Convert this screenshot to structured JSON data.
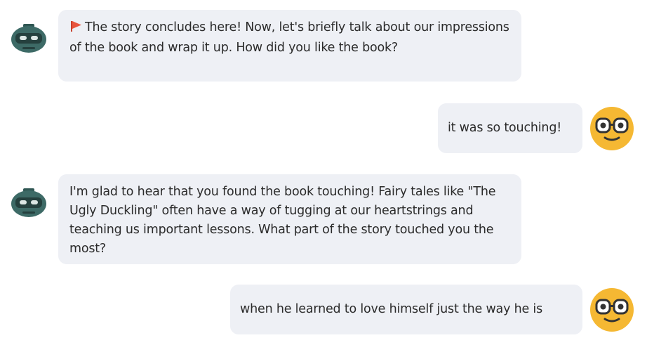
{
  "messages": [
    {
      "sender": "bot",
      "flag_icon": "red-flag-icon",
      "text": "The story concludes here! Now, let's briefly talk about our impressions of the book and wrap it up. How did you like the book?"
    },
    {
      "sender": "user",
      "text": "it was so touching!"
    },
    {
      "sender": "bot",
      "text": "I'm glad to hear that you found the book touching! Fairy tales like \"The Ugly Duckling\" often have a way of tugging at our heartstrings and teaching us important lessons. What part of the story touched you the most?"
    },
    {
      "sender": "user",
      "text": "when he learned to love himself just the way he is"
    }
  ],
  "avatars": {
    "bot": "robot-avatar-icon",
    "user": "smiley-glasses-avatar-icon"
  },
  "colors": {
    "bubble": "#eef0f5",
    "flag": "#e8553e",
    "user_avatar": "#f5b833",
    "bot_avatar": "#3d6a66"
  }
}
